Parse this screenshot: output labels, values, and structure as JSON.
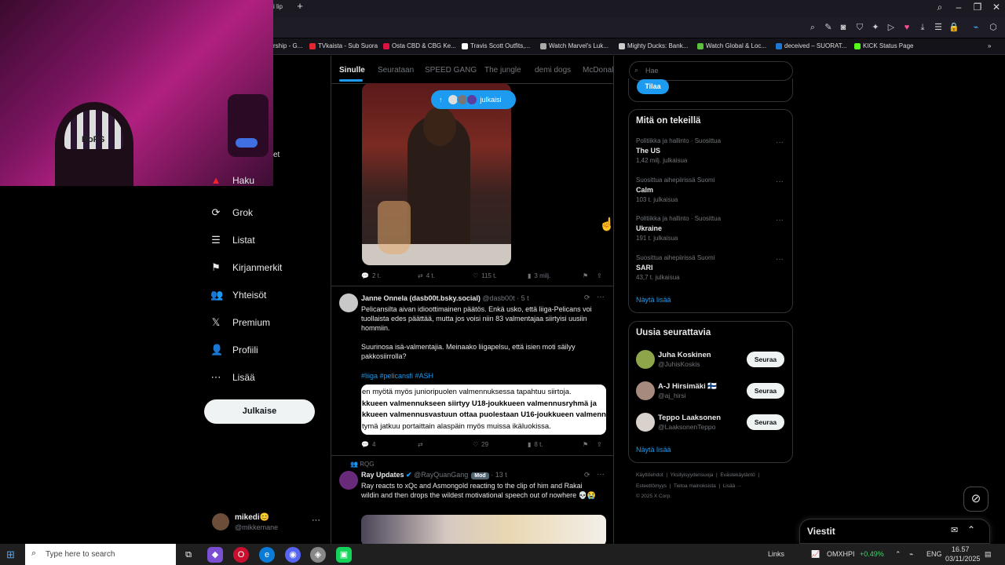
{
  "browser": {
    "tab_title": "i lip",
    "bookmarks": [
      "rship - G...",
      "TVkaista - Sub Suora",
      "Osta CBD & CBG Ke...",
      "Travis Scott Outfits,...",
      "Watch Marvel's Luk...",
      "Mighty Ducks: Bank...",
      "Watch Global & Loc...",
      "deceived – SUORAT...",
      "KICK Status Page"
    ]
  },
  "webcam": {
    "hat_text": "RoPS",
    "clipped_text": "et"
  },
  "sidebar": {
    "partial_label": "Haku",
    "items": [
      {
        "label": "Grok",
        "icon": "grok-icon",
        "glyph": "⟳"
      },
      {
        "label": "Listat",
        "icon": "list-icon",
        "glyph": "☰"
      },
      {
        "label": "Kirjanmerkit",
        "icon": "bookmark-icon",
        "glyph": "⚑"
      },
      {
        "label": "Yhteisöt",
        "icon": "communities-icon",
        "glyph": "👥"
      },
      {
        "label": "Premium",
        "icon": "x-icon",
        "glyph": "𝕏"
      },
      {
        "label": "Profiili",
        "icon": "profile-icon",
        "glyph": "👤"
      },
      {
        "label": "Lisää",
        "icon": "more-icon",
        "glyph": "⋯"
      }
    ],
    "post_button": "Julkaise",
    "user": {
      "name": "mikedi😊",
      "handle": "@mikkemane"
    }
  },
  "feed": {
    "tabs": [
      "Sinulle",
      "Seurataan",
      "SPEED GANG",
      "The jungle",
      "demi dogs",
      "McDonal"
    ],
    "new_posts_pill": "julkaisi",
    "post1_actions": {
      "replies": "2 t.",
      "reposts": "4 t.",
      "likes": "115 t.",
      "views": "3 milj."
    },
    "post2": {
      "name": "Janne Onnela (dasb00t.bsky.social)",
      "handle": "@dasb00t · 5 t",
      "text1": "Pelicansilta aivan idioottimainen päätös. Enkä usko, että liiga-Pelicans voi tuollaista edes päättää, mutta jos voisi niin 83 valmentajaa siirtyisi uusiin hommiin.",
      "text2": "Suurinosa isä-valmentajia. Meinaako liigapelsu, että isien moti säilyy pakkosiirrolla?",
      "hashtags": "#liiga #pelicansfi #ASH",
      "embed_lines": [
        "en myötä myös junioripuolen valmennuksessa tapahtuu siirtoja.",
        "kkueen valmennukseen siirtyy U18-joukkueen valmennusryhmä ja",
        "kkueen valmennusvastuun ottaa puolestaan U16-joukkueen valmennu",
        "tymä jatkuu portaittain alaspäin myös muissa ikäluokissa."
      ],
      "actions": {
        "replies": "4",
        "reposts": "",
        "likes": "29",
        "views": "8 t."
      }
    },
    "post3": {
      "context": "RQG",
      "name": "Ray Updates",
      "handle": "@RayQuanGang",
      "badge": "Mod",
      "time": "· 13 t",
      "text": "Ray reacts to xQc and Asmongold reacting to the clip of him and Rakai wildin and then drops the wildest motivational speech out of nowhere 💀😭"
    }
  },
  "right": {
    "search_placeholder": "Hae",
    "subscribe_button": "Tilaa",
    "trends_title": "Mitä on tekeillä",
    "trends": [
      {
        "meta": "Politiikka ja hallinto · Suosittua",
        "title": "The US",
        "count": "1,42 milj. julkaisua"
      },
      {
        "meta": "Suosittua aihepiirissä Suomi",
        "title": "Calm",
        "count": "103 t. julkaisua"
      },
      {
        "meta": "Politiikka ja hallinto · Suosittua",
        "title": "Ukraine",
        "count": "191 t. julkaisua"
      },
      {
        "meta": "Suosittua aihepiirissä Suomi",
        "title": "SARI",
        "count": "43,7 t. julkaisua"
      }
    ],
    "show_more": "Näytä lisää",
    "follow_title": "Uusia seurattavia",
    "follows": [
      {
        "name": "Juha Koskinen",
        "handle": "@JuhisKoskis",
        "button": "Seuraa",
        "color": "#8ea64a"
      },
      {
        "name": "A-J Hirsimäki 🇫🇮",
        "handle": "@aj_hirsi",
        "button": "Seuraa",
        "color": "#a78a7e"
      },
      {
        "name": "Teppo Laaksonen",
        "handle": "@LaaksonenTeppo",
        "button": "Seuraa",
        "color": "#d9d2cc"
      }
    ],
    "show_more2": "Näytä lisää",
    "footer_row1": [
      "Käyttöehdot",
      "Yksityisyydensuoja",
      "Evästekäytäntö"
    ],
    "footer_row2": [
      "Esteettömyys",
      "Tietoa mainoksista",
      "Lisää ···"
    ],
    "copyright": "© 2025 X Corp.",
    "messages_title": "Viestit"
  },
  "taskbar": {
    "search_placeholder": "Type here to search",
    "links": "Links",
    "ticker": "OMXHPI",
    "ticker_change": "+0.49%",
    "lang": "ENG",
    "time": "16.57",
    "date": "03/11/2025"
  },
  "colors": {
    "accent": "#1d9bf0",
    "background": "#000000",
    "border": "#2f3336"
  }
}
